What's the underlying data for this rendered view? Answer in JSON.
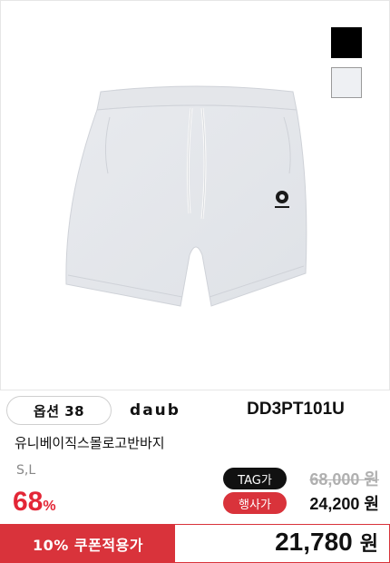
{
  "product": {
    "image_alt": "light gray shorts",
    "swatches": [
      {
        "name": "black",
        "color": "#000000"
      },
      {
        "name": "light-gray",
        "color": "#eef0f3"
      }
    ],
    "option_label": "옵션 38",
    "brand": "daub",
    "code": "DD3PT101U",
    "name": "유니베이직스몰로고반바지",
    "sizes": "S,L"
  },
  "pricing": {
    "discount_number": "68",
    "discount_percent_sign": "%",
    "tag_badge": "TAG가",
    "tag_price": "68,000 원",
    "sale_badge": "행사가",
    "sale_price": "24,200 원",
    "coupon_label": "10% 쿠폰적용가",
    "final_amount": "21,780",
    "final_currency": "원"
  },
  "colors": {
    "accent_red": "#d9333b",
    "discount_red": "#e32636"
  }
}
